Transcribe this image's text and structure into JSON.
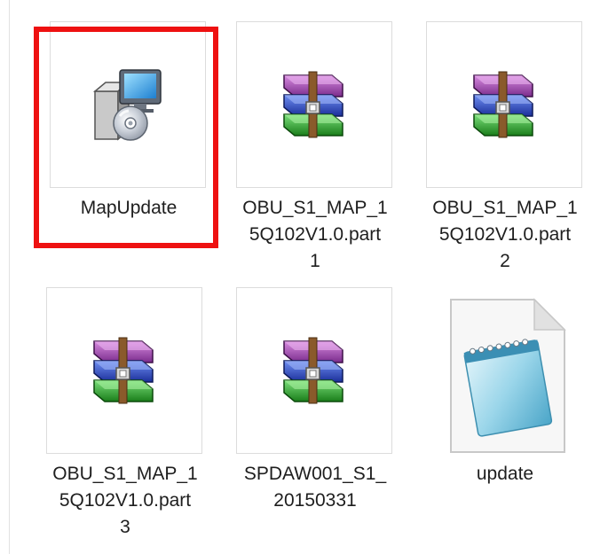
{
  "files": [
    {
      "name": "MapUpdate",
      "type": "installer",
      "icon": "installer-icon",
      "selected": true
    },
    {
      "name": "OBU_S1_MAP_1\n5Q102V1.0.part\n1",
      "type": "rar",
      "icon": "winrar-archive-icon"
    },
    {
      "name": "OBU_S1_MAP_1\n5Q102V1.0.part\n2",
      "type": "rar",
      "icon": "winrar-archive-icon"
    },
    {
      "name": "OBU_S1_MAP_1\n5Q102V1.0.part\n3",
      "type": "rar",
      "icon": "winrar-archive-icon"
    },
    {
      "name": "SPDAW001_S1_\n20150331",
      "type": "rar",
      "icon": "winrar-archive-icon"
    },
    {
      "name": "update",
      "type": "text",
      "icon": "notepad-document-icon"
    }
  ],
  "highlight": {
    "color": "#ee1111",
    "target": "MapUpdate"
  },
  "colors": {
    "thumb_border": "#dcdcdc",
    "text": "#1e1e1e"
  }
}
